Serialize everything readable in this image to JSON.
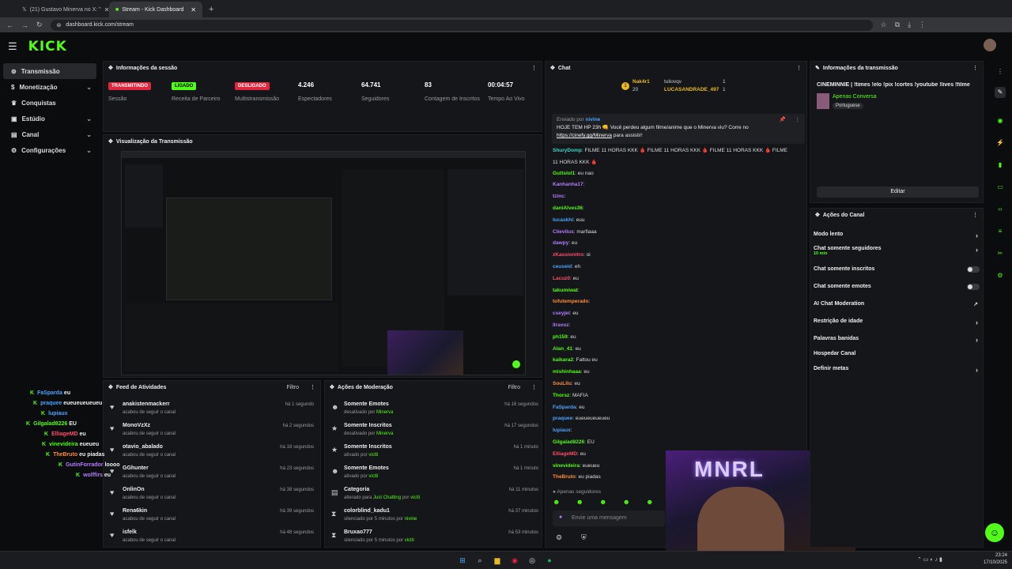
{
  "browser": {
    "tabs": [
      {
        "label": "(21) Gustavo Minerva no X: \"",
        "active": false
      },
      {
        "label": "Stream - Kick Dashboard",
        "active": true
      }
    ],
    "url": "dashboard.kick.com/stream"
  },
  "brand": {
    "logo": "KICK",
    "accent": "#53fc18"
  },
  "sidebar": {
    "items": [
      {
        "label": "Transmissão",
        "icon": "broadcast-icon"
      },
      {
        "label": "Monetização",
        "icon": "money-icon"
      },
      {
        "label": "Conquistas",
        "icon": "trophy-icon"
      },
      {
        "label": "Estúdio",
        "icon": "studio-icon"
      },
      {
        "label": "Canal",
        "icon": "channel-icon"
      },
      {
        "label": "Configurações",
        "icon": "gear-icon"
      }
    ]
  },
  "session": {
    "title": "Informações da sessão",
    "stats": [
      {
        "badge": "TRANSMITINDO",
        "label": "Sessão"
      },
      {
        "badge": "LIGADO",
        "label": "Receita de Parceiro"
      },
      {
        "badge": "DESLIGADO",
        "label": "Multistransmissão"
      },
      {
        "value": "4.246",
        "label": "Espectadores"
      },
      {
        "value": "64.741",
        "label": "Seguidores"
      },
      {
        "value": "83",
        "label": "Contagem de Inscritos"
      },
      {
        "value": "00:04:57",
        "label": "Tempo Ao Vivo"
      }
    ]
  },
  "preview": {
    "title": "Visualização da Transmissão"
  },
  "feed": {
    "title": "Feed de Atividades",
    "filter": "Filtro",
    "rows": [
      {
        "name": "anakistenmackerr",
        "sub": "acabou de seguir o canal",
        "time": "há 1 segundo"
      },
      {
        "name": "MonoVzXz",
        "sub": "acabou de seguir o canal",
        "time": "há 2 segundos"
      },
      {
        "name": "otavio_abalado",
        "sub": "acabou de seguir o canal",
        "time": "há 18 segundos"
      },
      {
        "name": "GGhunter",
        "sub": "acabou de seguir o canal",
        "time": "há 23 segundos"
      },
      {
        "name": "OnlinOn",
        "sub": "acabou de seguir o canal",
        "time": "há 38 segundos"
      },
      {
        "name": "Rena6kin",
        "sub": "acabou de seguir o canal",
        "time": "há 39 segundos"
      },
      {
        "name": "isfelk",
        "sub": "acabou de seguir o canal",
        "time": "há 48 segundos"
      }
    ]
  },
  "moderation": {
    "title": "Ações de Moderação",
    "filter": "Filtro",
    "rows": [
      {
        "name": "Somente Emotes",
        "pre": "desativado por",
        "by": "Minerva",
        "time": "há 16 segundos"
      },
      {
        "name": "Somente Inscritos",
        "pre": "desativado por",
        "by": "Minerva",
        "time": "há 17 segundos"
      },
      {
        "name": "Somente Inscritos",
        "pre": "ativado por",
        "by": "victti",
        "time": "há 1 minuto"
      },
      {
        "name": "Somente Emotes",
        "pre": "ativado por",
        "by": "victti",
        "time": "há 1 minuto"
      },
      {
        "name": "Categoria",
        "pre": "alterado para",
        "by": "Just Chatting",
        "pre2": "por",
        "by2": "victti",
        "time": "há 11 minutos"
      },
      {
        "name": "colorblind_kadu1",
        "pre": "silenciado por 5 minutos por",
        "by": "nivine",
        "time": "há 37 minutos"
      },
      {
        "name": "Bruxao777",
        "pre": "silenciado por 5 minutos por",
        "by": "victti",
        "time": "há 53 minutos"
      }
    ]
  },
  "chat": {
    "title": "Chat",
    "top_users": [
      {
        "name": "Nak4r1",
        "count": "20"
      },
      {
        "name": "tuliovqv",
        "count": "1"
      },
      {
        "name": "LUCASANDRADE_497",
        "count": "1"
      }
    ],
    "pinned": {
      "sent_by_label": "Enviado por",
      "sender": "nivine",
      "text": "HOJE TEM HP 23h 👊 Você perdeu algum filme/anime que o Minerva viu? Corre no",
      "link": "https://cinefy.gg/Minerva",
      "tail": "para assistir!"
    },
    "messages": [
      {
        "user": "ShuryDomp",
        "color": "#3bd6c6",
        "text": "FILME 11 HORAS KKK 🩸 FILME 11 HORAS KKK 🩸 FILME 11 HORAS KKK 🩸 FILME"
      },
      {
        "user": "",
        "color": "#ddd",
        "text": "11 HORAS KKK 🩸"
      },
      {
        "user": "Guttslol1",
        "color": "#53fc18",
        "text": "eu nao"
      },
      {
        "user": "Kanhanha17",
        "color": "#b37bff",
        "text": ""
      },
      {
        "user": "tzinc",
        "color": "#b37bff",
        "text": ""
      },
      {
        "user": "daniAlves36",
        "color": "#53fc18",
        "text": ""
      },
      {
        "user": "lucaskhi",
        "color": "#4aa3ff",
        "text": "euu"
      },
      {
        "user": "Clievlius",
        "color": "#b37bff",
        "text": "marfiaaa"
      },
      {
        "user": "dawpy",
        "color": "#b37bff",
        "text": "eu"
      },
      {
        "user": "zKassionitro",
        "color": "#ff4d6a",
        "text": "oi"
      },
      {
        "user": "ceuseid",
        "color": "#4aa3ff",
        "text": "eh"
      },
      {
        "user": "Lacuz0",
        "color": "#ff4d6a",
        "text": "eu"
      },
      {
        "user": "takumiwat",
        "color": "#53fc18",
        "text": ""
      },
      {
        "user": "tofutemperado",
        "color": "#ff8a3d",
        "text": ""
      },
      {
        "user": "cseyjei",
        "color": "#b37bff",
        "text": "eu"
      },
      {
        "user": "llravoz",
        "color": "#b37bff",
        "text": ""
      },
      {
        "user": "ph159",
        "color": "#53fc18",
        "text": "eu"
      },
      {
        "user": "Alan_41",
        "color": "#53fc18",
        "text": "eu"
      },
      {
        "user": "kaikara2",
        "color": "#53fc18",
        "text": "Faltou eu"
      },
      {
        "user": "mishinhaaa",
        "color": "#53fc18",
        "text": "eu"
      },
      {
        "user": "SouLilu",
        "color": "#ff8a3d",
        "text": "eu"
      },
      {
        "user": "Thorsz",
        "color": "#53fc18",
        "text": "MAFIA"
      },
      {
        "user": "FaSparda",
        "color": "#4aa3ff",
        "text": "eu"
      },
      {
        "user": "praquee",
        "color": "#4aa3ff",
        "text": "eueueueueueu"
      },
      {
        "user": "lupiaux",
        "color": "#4aa3ff",
        "text": ""
      },
      {
        "user": "Gilgalad8226",
        "color": "#53fc18",
        "text": "EU"
      },
      {
        "user": "ElliageMD",
        "color": "#ff4d6a",
        "text": "eu"
      },
      {
        "user": "vinevideira",
        "color": "#53fc18",
        "text": "eueueu"
      },
      {
        "user": "TheBruto",
        "color": "#ff8a3d",
        "text": "eu piadas"
      }
    ],
    "followers_only": "Apenas seguidores",
    "input_placeholder": "Envie uma mensagem"
  },
  "stream_info": {
    "title": "Informações da transmissão",
    "stream_title": "CINEMINNIE | !times !elo !pix !cortes !youtube !lives !filme",
    "category": "Apenas Conversa",
    "language": "Portuguese",
    "edit_label": "Editar"
  },
  "channel_actions": {
    "title": "Ações do Canal",
    "items": [
      {
        "label": "Modo lento",
        "control": "arrow"
      },
      {
        "label": "Chat somente seguidores",
        "sub": "10 min",
        "control": "arrow"
      },
      {
        "label": "Chat somente inscritos",
        "control": "toggle"
      },
      {
        "label": "Chat somente emotes",
        "control": "toggle"
      },
      {
        "label": "AI Chat Moderation",
        "control": "external"
      },
      {
        "label": "Restrição de idade",
        "control": "arrow"
      },
      {
        "label": "Palavras banidas",
        "control": "arrow"
      },
      {
        "label": "Hospedar Canal",
        "control": "none"
      },
      {
        "label": "Definir metas",
        "control": "arrow"
      }
    ]
  },
  "overlay_chat": [
    {
      "user": "FaSparda",
      "color": "#4aa3ff",
      "text": "eu"
    },
    {
      "user": "praquee",
      "color": "#4aa3ff",
      "text": "eueueueueueu"
    },
    {
      "user": "lupiaux",
      "color": "#4aa3ff",
      "text": ""
    },
    {
      "user": "Gilgalad8226",
      "color": "#53fc18",
      "text": "EU"
    },
    {
      "user": "ElliageMD",
      "color": "#ff4d6a",
      "text": "eu"
    },
    {
      "user": "vinevideira",
      "color": "#53fc18",
      "text": "eueueu"
    },
    {
      "user": "TheBruto",
      "color": "#ff8a3d",
      "text": "eu piadas"
    },
    {
      "user": "GutinForrador",
      "color": "#b37bff",
      "text": "loooo"
    },
    {
      "user": "wolffirs",
      "color": "#b37bff",
      "text": "eu"
    }
  ],
  "taskbar": {
    "time": "23:24",
    "date": "17/10/2025"
  }
}
